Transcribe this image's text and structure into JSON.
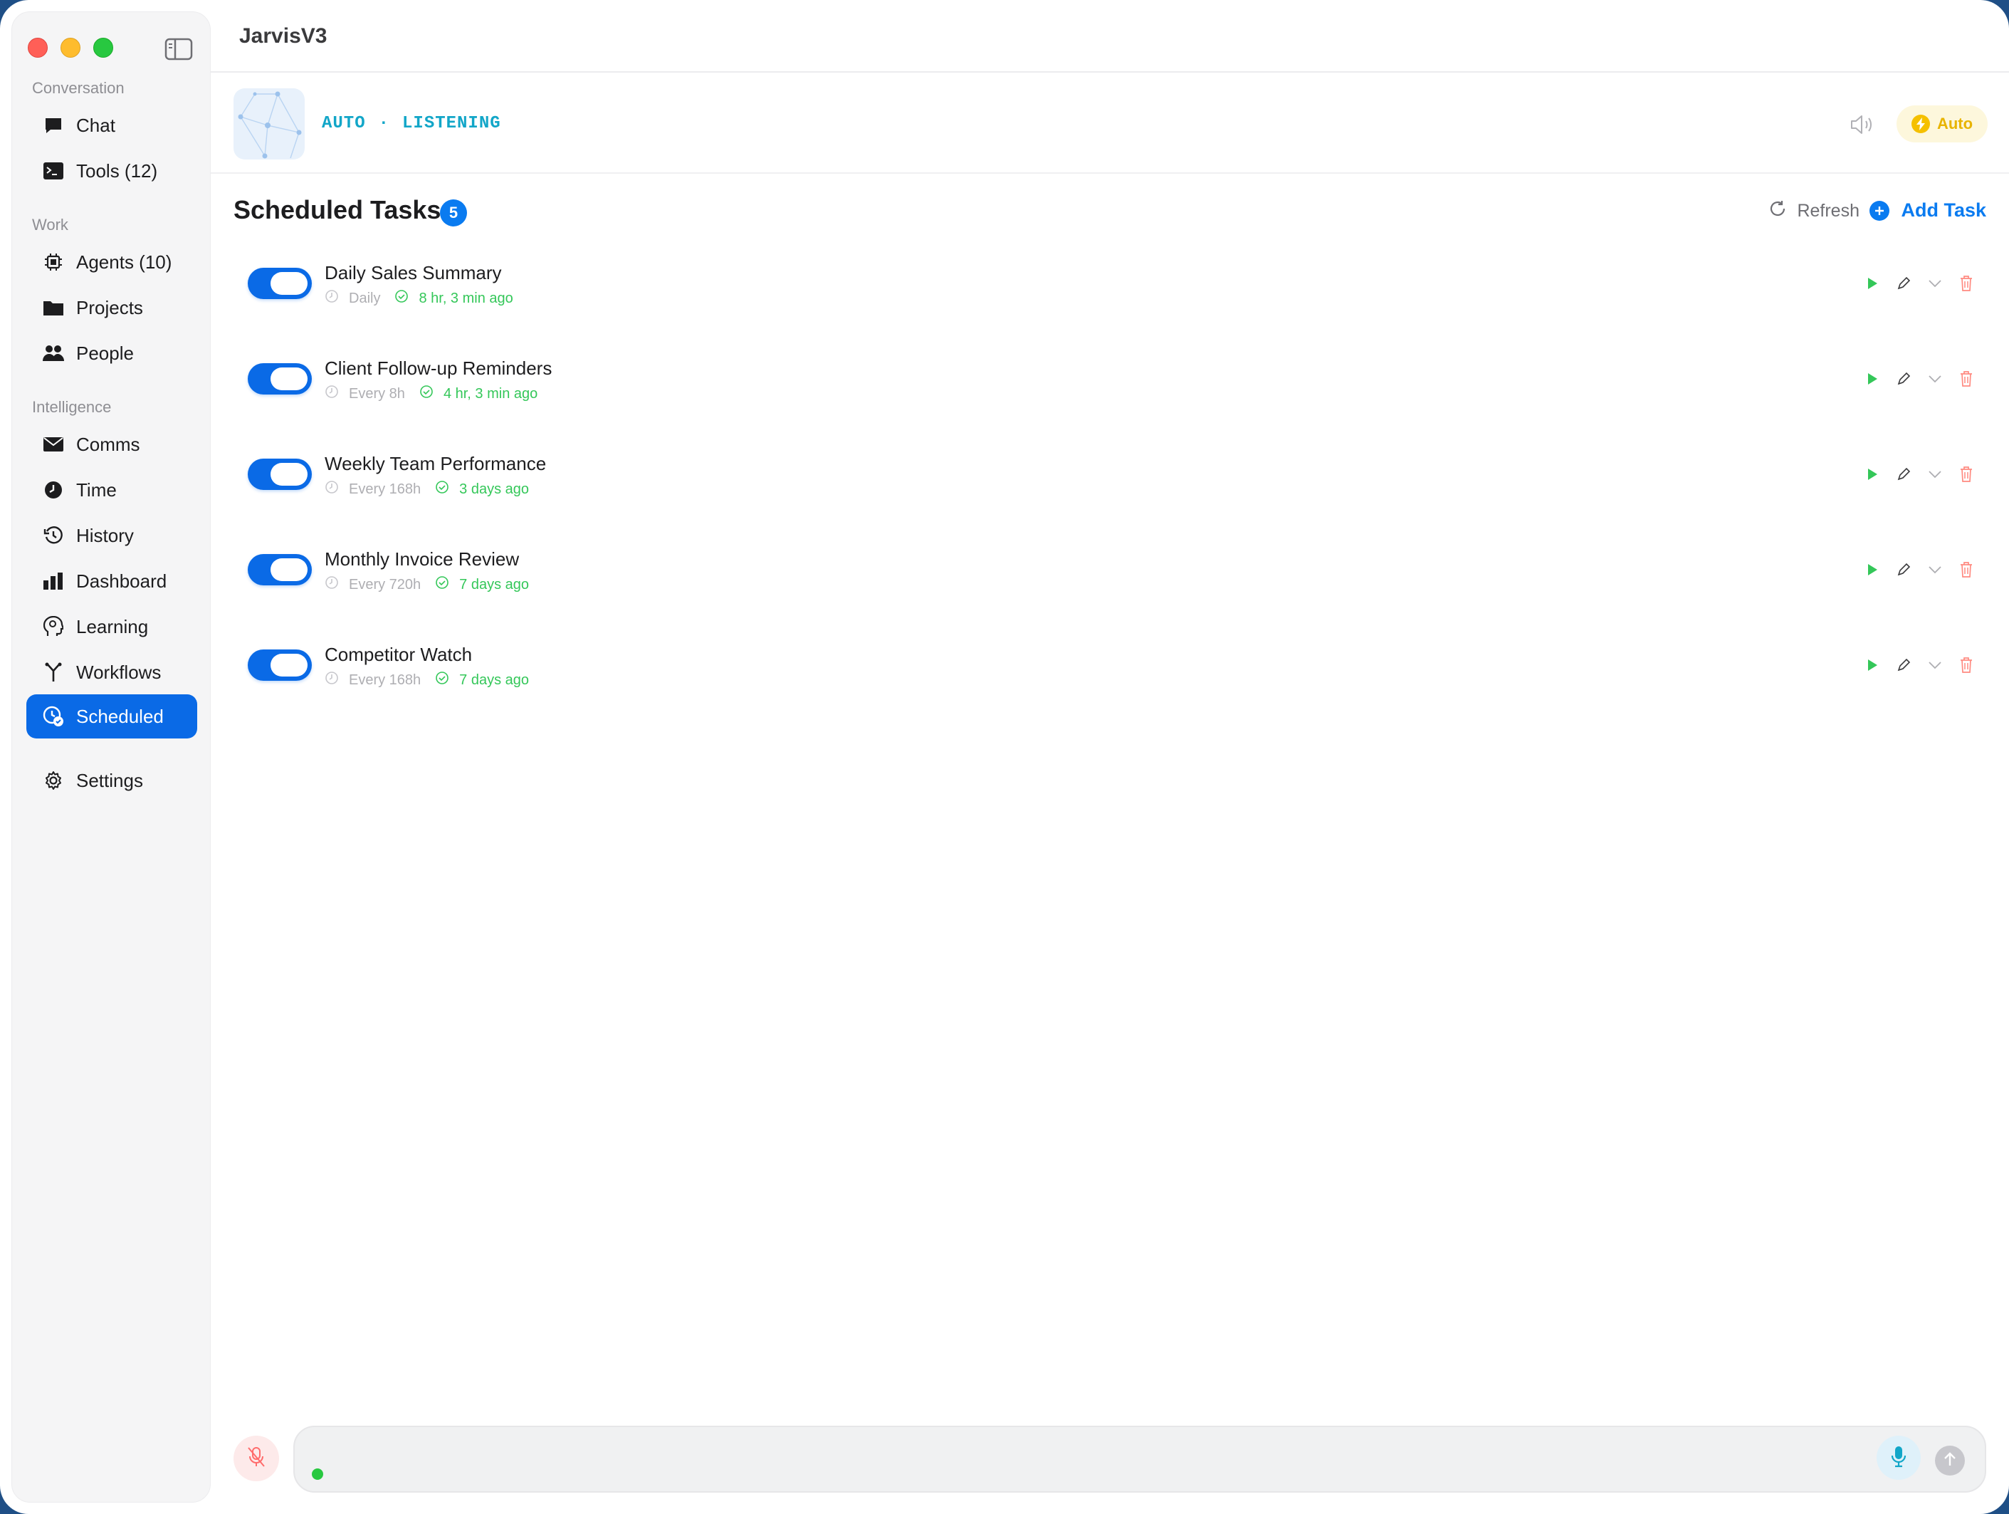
{
  "app": {
    "title": "JarvisV3"
  },
  "sidebar": {
    "sections": {
      "conversation": "Conversation",
      "work": "Work",
      "intelligence": "Intelligence"
    },
    "items": {
      "chat": "Chat",
      "tools": "Tools (12)",
      "agents": "Agents (10)",
      "projects": "Projects",
      "people": "People",
      "comms": "Comms",
      "time": "Time",
      "history": "History",
      "dashboard": "Dashboard",
      "learning": "Learning",
      "workflows": "Workflows",
      "scheduled": "Scheduled",
      "settings": "Settings"
    },
    "active_item": "scheduled"
  },
  "status": {
    "mode": "AUTO",
    "separator": "·",
    "state": "LISTENING",
    "auto_pill_label": "Auto"
  },
  "page": {
    "title": "Scheduled Tasks",
    "count": "5",
    "refresh_label": "Refresh",
    "add_label": "Add Task"
  },
  "tasks": [
    {
      "name": "Daily Sales Summary",
      "frequency": "Daily",
      "last_run": "8 hr, 3 min ago",
      "enabled": true
    },
    {
      "name": "Client Follow-up Reminders",
      "frequency": "Every 8h",
      "last_run": "4 hr, 3 min ago",
      "enabled": true
    },
    {
      "name": "Weekly Team Performance",
      "frequency": "Every 168h",
      "last_run": "3 days ago",
      "enabled": true
    },
    {
      "name": "Monthly Invoice Review",
      "frequency": "Every 720h",
      "last_run": "7 days ago",
      "enabled": true
    },
    {
      "name": "Competitor Watch",
      "frequency": "Every 168h",
      "last_run": "7 days ago",
      "enabled": true
    }
  ],
  "composer": {
    "value": "",
    "placeholder": ""
  },
  "colors": {
    "accent": "#0a6ae6",
    "listening": "#12a6c8",
    "success": "#34c759",
    "auto": "#f5c000",
    "danger": "#ff3b30"
  }
}
